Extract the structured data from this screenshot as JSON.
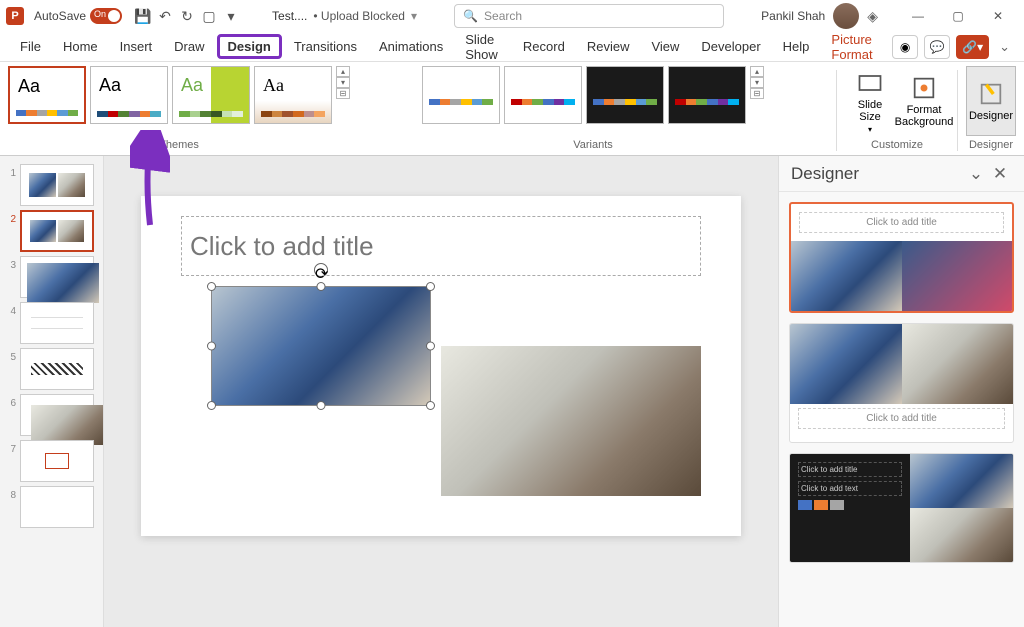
{
  "titlebar": {
    "autosave": "AutoSave",
    "autosave_state": "On",
    "filename": "Test....",
    "upload_status": "• Upload Blocked",
    "search_placeholder": "Search",
    "user_name": "Pankil Shah"
  },
  "tabs": {
    "file": "File",
    "home": "Home",
    "insert": "Insert",
    "draw": "Draw",
    "design": "Design",
    "transitions": "Transitions",
    "animations": "Animations",
    "slideshow": "Slide Show",
    "record": "Record",
    "review": "Review",
    "view": "View",
    "developer": "Developer",
    "help": "Help",
    "picture_format": "Picture Format"
  },
  "ribbon": {
    "themes_label": "Themes",
    "variants_label": "Variants",
    "customize_label": "Customize",
    "designer_label": "Designer",
    "slide_size": "Slide Size",
    "format_bg": "Format Background",
    "designer_btn": "Designer",
    "aa": "Aa"
  },
  "designer": {
    "title": "Designer",
    "card_title": "Click to add title",
    "card_title2": "Click to add title",
    "card_text": "Click to add text"
  },
  "slide": {
    "title_ph": "Click to add title"
  },
  "thumbs": [
    "1",
    "2",
    "3",
    "4",
    "5",
    "6",
    "7",
    "8"
  ]
}
